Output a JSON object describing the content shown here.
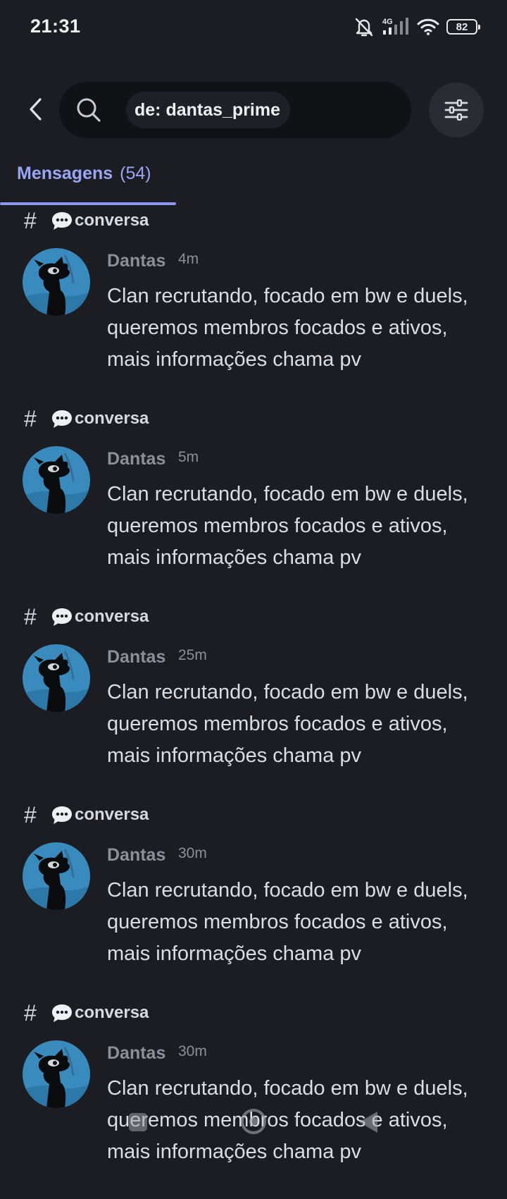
{
  "status_bar": {
    "time": "21:31",
    "network": "4G",
    "battery": "82",
    "icons": [
      "bell-muted-icon",
      "signal-icon",
      "wifi-icon",
      "battery-icon"
    ]
  },
  "search": {
    "query": "de: dantas_prime",
    "back_icon": "chevron-left-icon",
    "search_icon": "search-icon",
    "filter_icon": "sliders-icon"
  },
  "tabs": [
    {
      "label": "Mensagens",
      "count": "(54)",
      "active": true
    }
  ],
  "colors": {
    "background": "#1c1d22",
    "accent": "#9aa6f5",
    "search_bg": "#111216"
  },
  "messages": [
    {
      "channel": "conversa",
      "author": "Dantas",
      "time": "4m",
      "text": "Clan recrutando, focado em bw e duels, queremos membros focados e ativos, mais informações chama pv"
    },
    {
      "channel": "conversa",
      "author": "Dantas",
      "time": "5m",
      "text": "Clan recrutando, focado em bw e duels, queremos membros focados e ativos, mais informações chama pv"
    },
    {
      "channel": "conversa",
      "author": "Dantas",
      "time": "25m",
      "text": "Clan recrutando, focado em bw e duels, queremos membros focados e ativos, mais informações chama pv"
    },
    {
      "channel": "conversa",
      "author": "Dantas",
      "time": "30m",
      "text": "Clan recrutando, focado em bw e duels, queremos membros focados e ativos, mais informações chama pv"
    },
    {
      "channel": "conversa",
      "author": "Dantas",
      "time": "30m",
      "text": "Clan recrutando, focado em bw e duels, queremos membros focados e ativos, mais informações chama pv"
    }
  ]
}
